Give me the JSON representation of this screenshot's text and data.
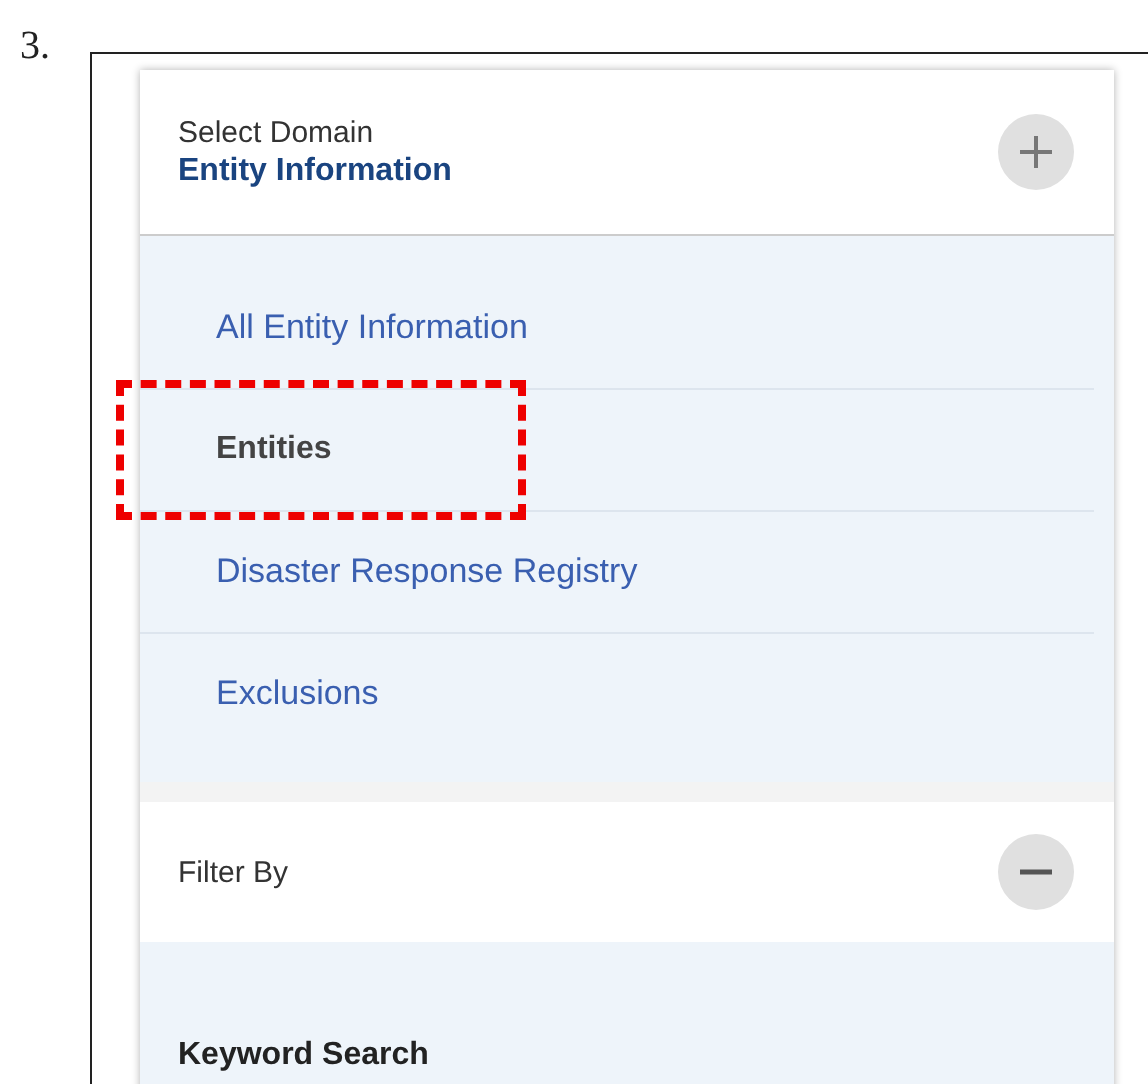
{
  "step_number": "3.",
  "domain_panel": {
    "label": "Select Domain",
    "value": "Entity Information",
    "items": [
      {
        "label": "All Entity Information",
        "selected": false,
        "highlighted": false
      },
      {
        "label": "Entities",
        "selected": true,
        "highlighted": true
      },
      {
        "label": "Disaster Response Registry",
        "selected": false,
        "highlighted": false
      },
      {
        "label": "Exclusions",
        "selected": false,
        "highlighted": false
      }
    ]
  },
  "filter_panel": {
    "title": "Filter By",
    "section": "Keyword Search"
  }
}
